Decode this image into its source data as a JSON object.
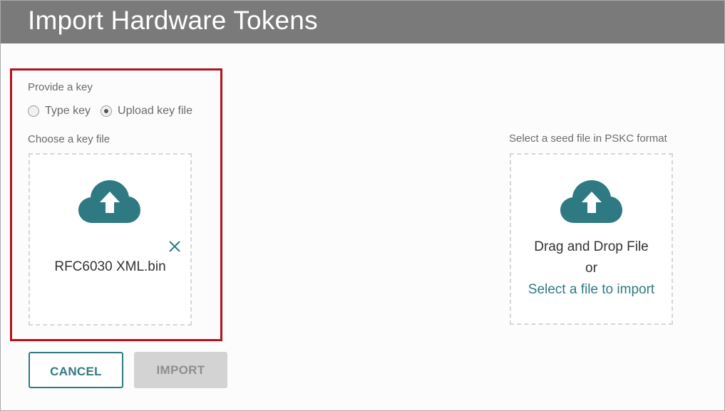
{
  "dialog": {
    "title": "Import Hardware Tokens"
  },
  "key_section": {
    "provide_label": "Provide a key",
    "options": [
      {
        "label": "Type key",
        "selected": false
      },
      {
        "label": "Upload key file",
        "selected": true
      }
    ],
    "choose_label": "Choose a key file",
    "upload_icon": "cloud-upload-icon",
    "file_name": "RFC6030 XML.bin",
    "remove_icon": "close-icon"
  },
  "seed_section": {
    "label": "Select a seed file in PSKC format",
    "upload_icon": "cloud-upload-icon",
    "drag_text": "Drag and Drop File",
    "or_text": "or",
    "select_link": "Select a file to import"
  },
  "buttons": {
    "cancel": "CANCEL",
    "import": "IMPORT"
  },
  "colors": {
    "header_bg": "#7a7a7a",
    "accent": "#2f7a82",
    "highlight": "#b3121e",
    "disabled_bg": "#d3d3d3"
  }
}
